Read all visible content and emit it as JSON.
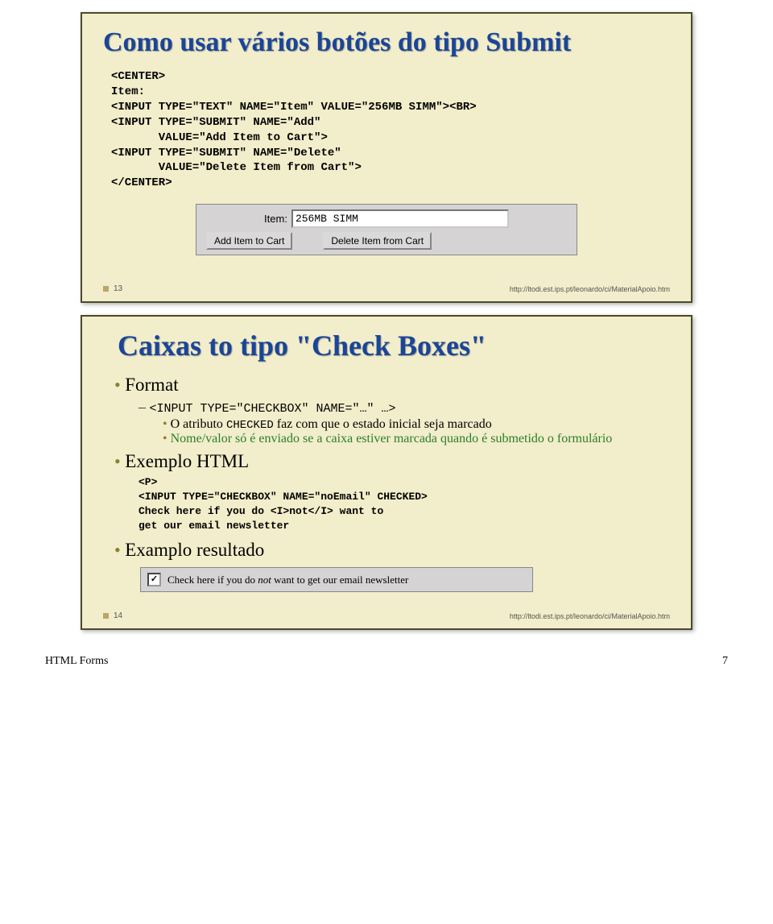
{
  "slide1": {
    "title": "Como usar vários botões do tipo Submit",
    "code": "<CENTER>\nItem:\n<INPUT TYPE=\"TEXT\" NAME=\"Item\" VALUE=\"256MB SIMM\"><BR>\n<INPUT TYPE=\"SUBMIT\" NAME=\"Add\"\n       VALUE=\"Add Item to Cart\">\n<INPUT TYPE=\"SUBMIT\" NAME=\"Delete\"\n       VALUE=\"Delete Item from Cart\">\n</CENTER>",
    "form": {
      "label": "Item:",
      "input_value": "256MB SIMM",
      "btn_add": "Add Item to Cart",
      "btn_delete": "Delete Item from Cart"
    },
    "footer_num": "13",
    "footer_url": "http://ltodi.est.ips.pt/leonardo/ci/MaterialApoio.htm"
  },
  "slide2": {
    "title": "Caixas to tipo \"Check Boxes\"",
    "b1": "Format",
    "b1_sub_code": "<INPUT TYPE=\"CHECKBOX\" NAME=\"…\" …>",
    "b1_sub1": "O atributo ",
    "b1_sub1_mono": "CHECKED",
    "b1_sub1_tail": " faz com que o estado inicial seja marcado",
    "b1_sub2": "Nome/valor só é enviado se a caixa estiver marcada quando é submetido o formulário",
    "b2": "Exemplo HTML",
    "code2": "<P>\n<INPUT TYPE=\"CHECKBOX\" NAME=\"noEmail\" CHECKED>\nCheck here if you do <I>not</I> want to\nget our email newsletter",
    "b3": "Examplo resultado",
    "check_label_1": "Check here if you do ",
    "check_label_em": "not",
    "check_label_2": " want to get our email newsletter",
    "footer_num": "14",
    "footer_url": "http://ltodi.est.ips.pt/leonardo/ci/MaterialApoio.htm"
  },
  "page_footer": {
    "left": "HTML Forms",
    "right": "7"
  }
}
